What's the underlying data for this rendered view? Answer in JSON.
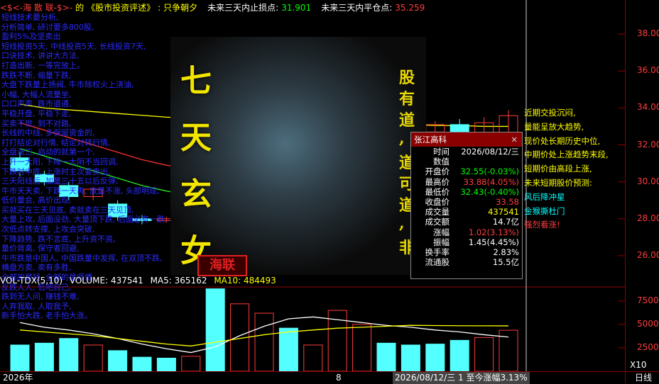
{
  "topbar": {
    "segments": [
      {
        "text": "<$<-海 散 联-$>-",
        "color": "#ff3c3c"
      },
      {
        "text": "的",
        "color": "#ffff00"
      },
      {
        "text": "《股市投资评述》",
        "color": "#ffff00"
      },
      {
        "text": ":",
        "color": "#ffff00"
      },
      {
        "text": "只争朝夕",
        "color": "#ffff00"
      },
      {
        "text": "未来三天内止损点:",
        "color": "#ffffff"
      },
      {
        "text": "31.901",
        "color": "#00ff00"
      },
      {
        "text": "未来三天内平仓点:",
        "color": "#ffffff"
      },
      {
        "text": "35.259",
        "color": "#ff3c3c"
      }
    ]
  },
  "left_notes": [
    "短线技术要分析,",
    "分析简单,  研讨要多800股,",
    "盈利5%及坚卖出",
    "短线投资5天,  中线投资5天,  长线投资7天,",
    "口诀技术,  讲讲大方法,",
    "打造出新,  一等完放上。",
    "跌跌不断,  缩量下跌,",
    "大盘下跌量上扬阀,  牛市除权火上浇油,",
    "小幅,  大幅人流量坐,",
    "口口声声,  跌市道通,",
    "平稳开盘,  平稳下走,",
    "买卖不觉,  到不对路,",
    "长线的中线,  多保留资金的,",
    "打打结论对行情,  结论对转行情,",
    "全盘涨三,  启动的就第一个,",
    "上升一大阳,  下降一大阴不当回调,",
    "下跌时中底,  上涨时主次要卖出,",
    "三天阳线后,  加量三十五以后反弹,",
    "牛市天天卖,  下跌一天再,  放量不涨,  头部明现,",
    "低价量会,  高价出现,",
    "买就买在三天见底,  卖就卖在三天见顶,",
    "大量上攻,  后面没劲,  大量顶下跌,  后面必有一跌,",
    "次低点转支撑,  上攻会突破,",
    "下降趋势,  跌不言底,  上升资不资,",
    "量价背离,  保守者回避,",
    "牛市跌是中国人,  中国跌量中发挥,  在双顶不跌,",
    "横盘方卖,  卖有多胜,",
    "全部的是钱,  全部的是师傅,",
    "反跌人人,  低吧自己,",
    "跌到无人问,  赚钱不难,",
    "人弃我取,  人取我予,",
    "新手怕大跌,  老手怕大涨。"
  ],
  "poster": {
    "big_chars": [
      "七",
      "天",
      "玄",
      "女"
    ],
    "vertical_chars": [
      "股",
      "有",
      "道",
      ",",
      "道",
      "可",
      "道",
      ",",
      "非"
    ],
    "stamp": "海联"
  },
  "right_notes": [
    {
      "text": "近期交投沉闷,",
      "color": "#ffff00"
    },
    {
      "text": "量能呈放大趋势,",
      "color": "#ffff00"
    },
    {
      "text": "现价处长期历史中位,",
      "color": "#ffff00"
    },
    {
      "text": "中期价处上涨趋势末段,",
      "color": "#ffff00"
    },
    {
      "text": "短期价由高段上涨,",
      "color": "#ffff00"
    },
    {
      "text": "未来短期股价预测:",
      "color": "#ffff00"
    },
    {
      "text": "风后降冲星",
      "color": "#00ffff"
    },
    {
      "text": "金猴撕杜门",
      "color": "#00ffff"
    },
    {
      "text": "强烈看涨!",
      "color": "#ff3c3c"
    }
  ],
  "y_axis": {
    "ticks": [
      "38.00",
      "36.00",
      "34.00",
      "32.00",
      "30.00",
      "28.00",
      "26.00"
    ]
  },
  "vol_axis": {
    "ticks": [
      "75000",
      "50000",
      "25000"
    ],
    "unit": "X10"
  },
  "vol_header": {
    "name": "VOL-TDX(5,10)",
    "volume": "VOLUME: 437541",
    "ma5": "MA5: 365162",
    "ma10": "MA10: 484493"
  },
  "info_panel": {
    "title": "张江高科",
    "rows": [
      {
        "k": "时间",
        "v": "2026/08/12/三",
        "color": "#ffffff"
      },
      {
        "k": "数值",
        "v": "",
        "color": "#ffffff"
      },
      {
        "k": "开盘价",
        "v": "32.55(-0.03%)",
        "color": "#00ff00"
      },
      {
        "k": "最高价",
        "v": "33.88(4.05%)",
        "color": "#ff3c3c"
      },
      {
        "k": "最低价",
        "v": "32.43(-0.40%)",
        "color": "#00ff00"
      },
      {
        "k": "收盘价",
        "v": "33.58",
        "color": "#ff3c3c"
      },
      {
        "k": "成交量",
        "v": "437541",
        "color": "#ffff00"
      },
      {
        "k": "成交额",
        "v": "14.7亿",
        "color": "#ffffff"
      },
      {
        "k": "涨幅",
        "v": "1.02(3.13%)",
        "color": "#ff3c3c"
      },
      {
        "k": "振幅",
        "v": "1.45(4.45%)",
        "color": "#ffffff"
      },
      {
        "k": "换手率",
        "v": "2.83%",
        "color": "#ffffff"
      },
      {
        "k": "流通股",
        "v": "15.5亿",
        "color": "#ffffff"
      }
    ]
  },
  "bottom_bar": {
    "year": "2026年",
    "month": "8",
    "status": "2026/08/12/三 1 至今涨幅3.13%",
    "period": "日线"
  },
  "chart_data": {
    "type": "candlestick",
    "price_axis": {
      "ylim": [
        25,
        39
      ]
    },
    "candles": [
      {
        "o": 31.3,
        "c": 30.6,
        "h": 31.6,
        "l": 30.3
      },
      {
        "o": 30.4,
        "c": 30.0,
        "h": 30.6,
        "l": 29.8
      },
      {
        "o": 29.8,
        "c": 29.2,
        "h": 30.0,
        "l": 29.0
      },
      {
        "o": 29.2,
        "c": 29.6,
        "h": 29.7,
        "l": 29.0
      },
      {
        "o": 28.8,
        "c": 28.1,
        "h": 29.0,
        "l": 27.9
      },
      {
        "o": 28.0,
        "c": 27.9,
        "h": 28.2,
        "l": 27.7
      },
      {
        "o": 27.9,
        "c": 28.0,
        "h": 28.1,
        "l": 27.8
      },
      {
        "o": 28.0,
        "c": 28.3,
        "h": 28.6,
        "l": 27.9
      },
      {
        "o": 29.0,
        "c": 30.0,
        "h": 30.6,
        "l": 28.7
      },
      {
        "o": 30.5,
        "c": 31.8,
        "h": 32.2,
        "l": 30.2
      },
      {
        "o": 31.8,
        "c": 31.4,
        "h": 32.1,
        "l": 31.1
      },
      {
        "o": 30.5,
        "c": 31.1,
        "h": 31.5,
        "l": 30.4
      },
      {
        "o": 31.3,
        "c": 30.4,
        "h": 31.5,
        "l": 30.2
      },
      {
        "o": 30.8,
        "c": 31.3,
        "h": 31.5,
        "l": 30.6
      },
      {
        "o": 31.2,
        "c": 33.1,
        "h": 33.6,
        "l": 31.0
      },
      {
        "o": 32.8,
        "c": 32.9,
        "h": 33.3,
        "l": 32.5
      },
      {
        "o": 32.6,
        "c": 32.7,
        "h": 33.2,
        "l": 32.4
      },
      {
        "o": 32.7,
        "c": 33.1,
        "h": 33.3,
        "l": 32.5
      },
      {
        "o": 33.1,
        "c": 32.6,
        "h": 33.4,
        "l": 32.4
      },
      {
        "o": 32.6,
        "c": 33.2,
        "h": 33.5,
        "l": 32.3
      },
      {
        "o": 32.55,
        "c": 33.58,
        "h": 33.88,
        "l": 32.43
      }
    ],
    "volume_axis": {
      "ylim": [
        0,
        90000
      ]
    },
    "volumes": [
      {
        "v": 28000,
        "up": false
      },
      {
        "v": 30000,
        "up": false
      },
      {
        "v": 35000,
        "up": false
      },
      {
        "v": 28000,
        "up": true
      },
      {
        "v": 22000,
        "up": false
      },
      {
        "v": 15000,
        "up": false
      },
      {
        "v": 14000,
        "up": false
      },
      {
        "v": 16000,
        "up": true
      },
      {
        "v": 88000,
        "up": false
      },
      {
        "v": 72000,
        "up": true
      },
      {
        "v": 62000,
        "up": true
      },
      {
        "v": 46000,
        "up": false
      },
      {
        "v": 28000,
        "up": true
      },
      {
        "v": 65000,
        "up": true
      },
      {
        "v": 50000,
        "up": true
      },
      {
        "v": 30000,
        "up": false
      },
      {
        "v": 28000,
        "up": false
      },
      {
        "v": 29000,
        "up": false
      },
      {
        "v": 33000,
        "up": false
      },
      {
        "v": 36000,
        "up": true
      },
      {
        "v": 43754,
        "up": true
      }
    ],
    "ma_price_yellow": [
      34.2,
      34.0,
      33.9,
      33.8,
      33.7,
      33.6,
      33.5,
      33.45,
      33.4,
      33.35,
      33.3,
      33.25,
      33.2,
      33.2,
      33.15,
      33.1,
      33.1,
      33.05,
      33.05,
      33.0,
      33.0
    ],
    "ma_price_red": [
      33.2,
      32.8,
      32.4,
      32.0,
      31.6,
      31.2,
      30.9,
      30.7,
      30.6,
      30.6,
      30.7,
      30.8,
      30.9,
      31.0,
      31.2,
      31.4,
      31.6,
      31.8,
      32.0,
      32.2,
      32.4
    ],
    "ma_price_green": [
      31.8,
      31.4,
      31.0,
      30.6,
      30.2,
      29.8,
      29.5,
      29.3,
      29.2,
      29.2,
      29.3,
      29.5,
      29.7,
      30.0,
      30.3,
      30.7,
      31.1,
      31.4,
      31.7,
      31.9,
      32.1
    ],
    "ma_vol_white": [
      52000,
      47000,
      44000,
      40000,
      35000,
      29000,
      24000,
      20000,
      26000,
      38000,
      48000,
      56000,
      58000,
      55000,
      52000,
      49000,
      47000,
      44000,
      42000,
      39000,
      36516
    ],
    "ma_vol_yellow": [
      44000,
      42000,
      40000,
      38000,
      35000,
      32000,
      29000,
      27000,
      31000,
      35000,
      39000,
      42000,
      44000,
      46000,
      47000,
      48000,
      49000,
      48800,
      48600,
      48500,
      48449
    ]
  }
}
